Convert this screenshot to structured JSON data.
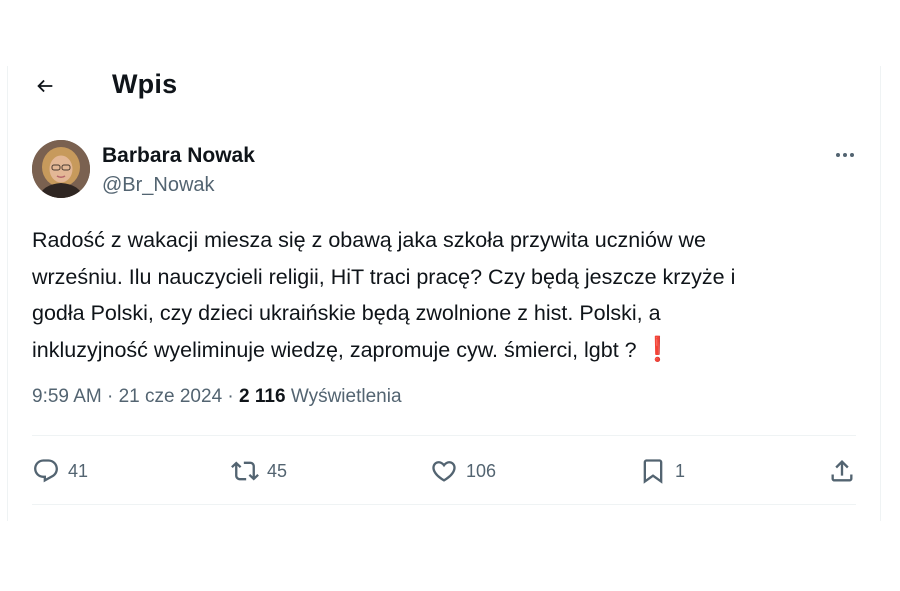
{
  "header": {
    "title": "Wpis"
  },
  "author": {
    "name": "Barbara Nowak",
    "handle": "@Br_Nowak"
  },
  "post": {
    "text": "Radość z wakacji miesza się z obawą jaka szkoła przywita uczniów we\nwrześniu. Ilu nauczycieli religii, HiT traci pracę? Czy będą jeszcze krzyże i\ngodła Polski, czy dzieci ukraińskie będą zwolnione z hist. Polski, a\ninkluzyjność wyeliminuje wiedzę, zapromuje cyw. śmierci, lgbt ?",
    "emoji": "❗",
    "time": "9:59 AM",
    "separator": "·",
    "date": "21 cze 2024",
    "views_count": "2 116",
    "views_label": "Wyświetlenia"
  },
  "actions": {
    "replies": "41",
    "reposts": "45",
    "likes": "106",
    "bookmarks": "1"
  },
  "icons": [
    "back-arrow-icon",
    "more-icon",
    "reply-icon",
    "repost-icon",
    "like-icon",
    "bookmark-icon",
    "share-icon"
  ],
  "colors": {
    "text": "#0f1419",
    "muted": "#536471",
    "divider": "#eff3f4",
    "emoji": "#dd1f2d"
  }
}
